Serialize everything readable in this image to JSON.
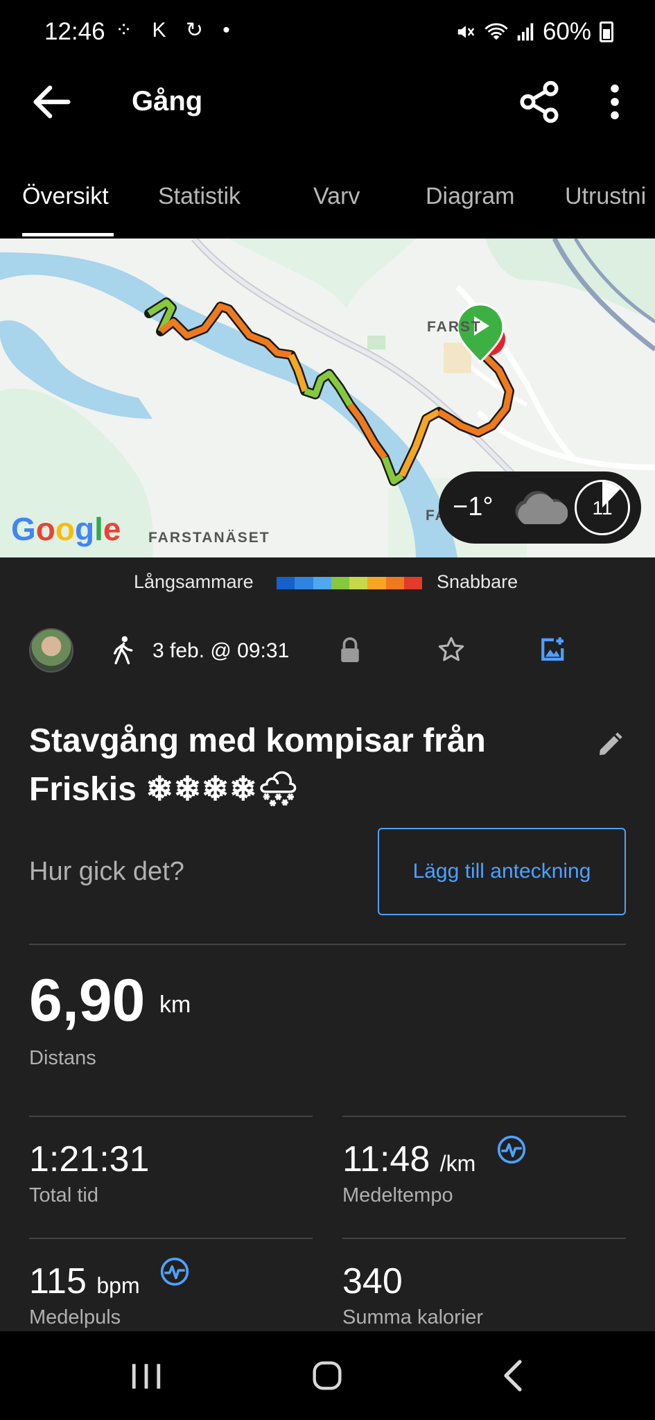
{
  "status_bar": {
    "time": "12:46",
    "left_icons": "⁘ K ↻ •",
    "battery": "60%"
  },
  "app_bar": {
    "title": "Gång"
  },
  "tabs": [
    {
      "label": "Översikt",
      "active": true
    },
    {
      "label": "Statistik",
      "active": false
    },
    {
      "label": "Varv",
      "active": false
    },
    {
      "label": "Diagram",
      "active": false
    },
    {
      "label": "Utrustni",
      "active": false
    }
  ],
  "map": {
    "labels": {
      "farsta_top": "FARST",
      "farsta_bottom": "FA",
      "farstanaset": "FARSTANÄSET"
    },
    "attribution": "Google",
    "weather": {
      "temperature": "−1°",
      "icon": "cloud-icon",
      "timer_value": "11"
    }
  },
  "pace_legend": {
    "slower": "Långsammare",
    "faster": "Snabbare",
    "colors": [
      "#1560c9",
      "#2f84e0",
      "#4fa7f0",
      "#86c93c",
      "#c7d84a",
      "#f5a623",
      "#ef7a1e",
      "#e33a2a"
    ]
  },
  "activity": {
    "date": "3 feb. @ 09:31",
    "title": "Stavgång med kompisar från Friskis ❄❄❄❄🌨",
    "prompt": "Hur gick det?",
    "add_note_label": "Lägg till anteckning"
  },
  "distance": {
    "value": "6,90",
    "unit": "km",
    "label": "Distans"
  },
  "stats": {
    "total_time": {
      "value": "1:21:31",
      "label": "Total tid"
    },
    "avg_pace": {
      "value": "11:48",
      "unit": "/km",
      "label": "Medeltempo"
    },
    "avg_hr": {
      "value": "115",
      "unit": "bpm",
      "label": "Medelpuls"
    },
    "calories": {
      "value": "340",
      "label": "Summa kalorier"
    }
  },
  "accent_color": "#4ea1ff"
}
